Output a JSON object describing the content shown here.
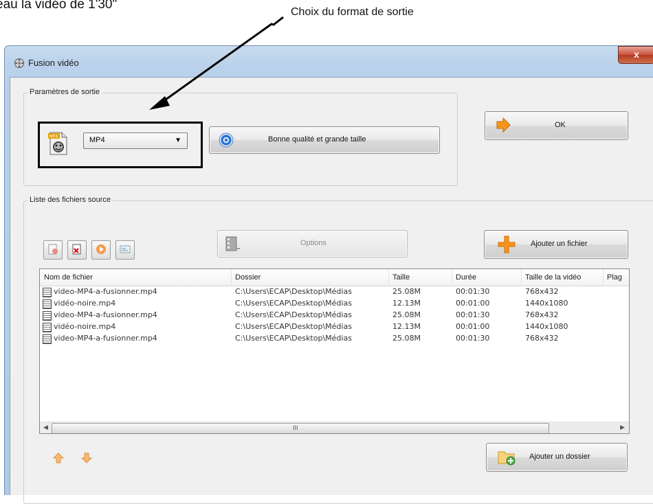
{
  "document": {
    "caption_left": "eau la vidéo de 1'30\"",
    "caption_right": "Choix du format de sortie"
  },
  "window": {
    "title": "Fusion vidéo",
    "close_label": "x"
  },
  "output_settings": {
    "group_label": "Paramètres de sortie",
    "format_icon_label": "MP4",
    "format_value": "MP4",
    "quality_button": "Bonne qualité et grande taille",
    "ok_button": "OK"
  },
  "source_files": {
    "group_label": "Liste des fichiers source",
    "toolbar_icons": [
      "remove-all-icon",
      "remove-item-icon",
      "play-icon",
      "properties-icon"
    ],
    "options_button": "Options",
    "add_file_button": "Ajouter un fichier",
    "add_folder_button": "Ajouter un dossier",
    "columns": [
      "Nom de fichier",
      "Dossier",
      "Taille",
      "Durée",
      "Taille de la vidéo",
      "Plag"
    ],
    "rows": [
      [
        "video-MP4-a-fusionner.mp4",
        "C:\\Users\\ECAP\\Desktop\\Médias",
        "25.08M",
        "00:01:30",
        "768x432"
      ],
      [
        "vidéo-noire.mp4",
        "C:\\Users\\ECAP\\Desktop\\Médias",
        "12.13M",
        "00:01:00",
        "1440x1080"
      ],
      [
        "video-MP4-a-fusionner.mp4",
        "C:\\Users\\ECAP\\Desktop\\Médias",
        "25.08M",
        "00:01:30",
        "768x432"
      ],
      [
        "vidéo-noire.mp4",
        "C:\\Users\\ECAP\\Desktop\\Médias",
        "12.13M",
        "00:01:00",
        "1440x1080"
      ],
      [
        "video-MP4-a-fusionner.mp4",
        "C:\\Users\\ECAP\\Desktop\\Médias",
        "25.08M",
        "00:01:30",
        "768x432"
      ]
    ],
    "scroll_grip": "III"
  },
  "colors": {
    "accent_orange": "#f7941d",
    "quality_blue": "#1f6fd0"
  }
}
